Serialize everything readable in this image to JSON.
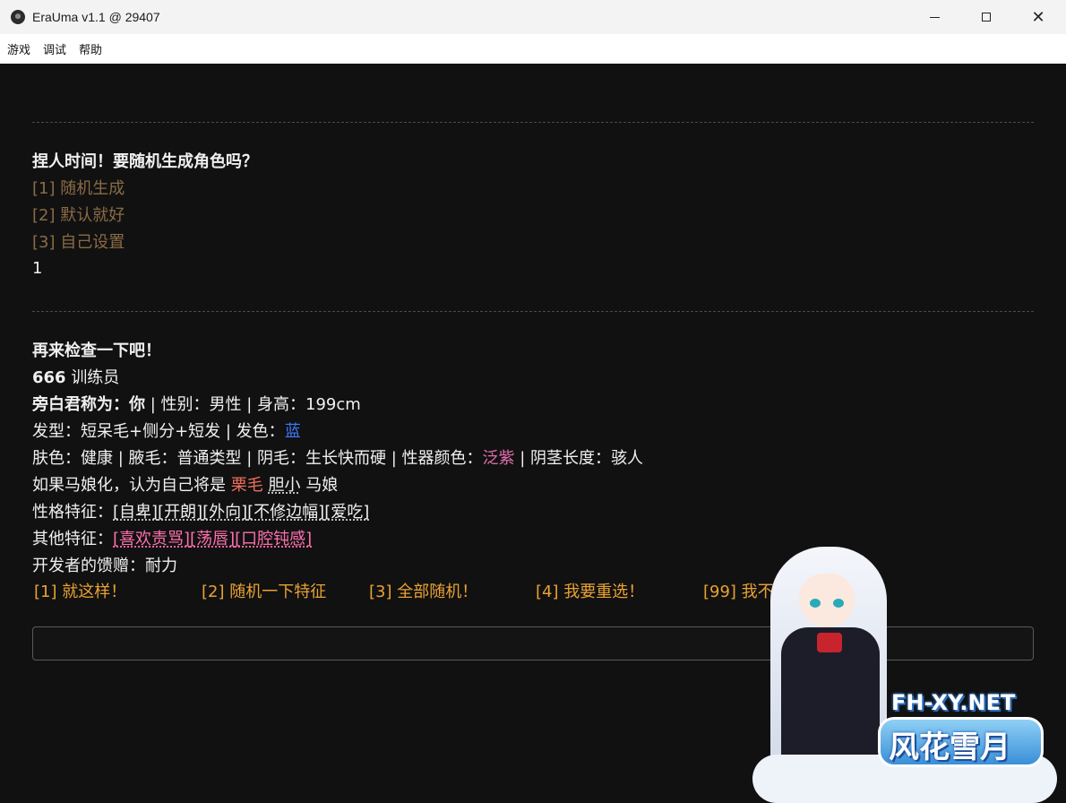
{
  "window": {
    "title": "EraUma v1.1 @ 29407"
  },
  "menu": [
    "游戏",
    "调试",
    "帮助"
  ],
  "section1": {
    "question": "捏人时间！要随机生成角色吗？",
    "options": [
      "[1] 随机生成",
      "[2] 默认就好",
      "[3] 自己设置"
    ],
    "answer": "1"
  },
  "section2": {
    "heading": "再来检查一下吧！",
    "id_line": {
      "number": "666",
      "role": "训练员"
    },
    "narration": {
      "label": "旁白君称为：",
      "value": "你",
      "gender_label": " | 性别：",
      "gender": "男性",
      "height_label": " | 身高：",
      "height": "199cm"
    },
    "hair": {
      "label": "发型：",
      "style": "短呆毛+侧分+短发",
      "color_label": " | 发色：",
      "color": "蓝"
    },
    "body": {
      "skin_label": "肤色：",
      "skin": "健康",
      "armpit_label": " | 腋毛：",
      "armpit": "普通类型",
      "pubic_label": " | 阴毛：",
      "pubic": "生长快而硬",
      "organ_color_label": " | 性器颜色：",
      "organ_color": "泛紫",
      "length_label": " | 阴茎长度：",
      "length": "骇人"
    },
    "uma": {
      "prefix": "如果马娘化，认为自己将是 ",
      "coat": "栗毛",
      "space1": " ",
      "temper": "胆小",
      "suffix": " 马娘"
    },
    "personality": {
      "label": "性格特征：",
      "traits": [
        "[自卑]",
        "[开朗]",
        "[外向]",
        "[不修边幅]",
        "[爱吃]"
      ]
    },
    "other": {
      "label": "其他特征：",
      "traits": [
        "[喜欢责骂]",
        "[荡唇]",
        "[口腔钝感]"
      ]
    },
    "gift": {
      "label": "开发者的馈赠：",
      "value": "耐力"
    }
  },
  "actions": [
    "[1] 就这样！",
    "[2] 随机一下特征",
    "[3] 全部随机！",
    "[4] 我要重选！",
    "[99] 我不玩了……"
  ],
  "watermark": {
    "site": "FH-XY.NET",
    "name": "风花雪月"
  },
  "colors": {
    "background": "#111111",
    "option": "#8a6b46",
    "action": "#e9a233",
    "blue": "#3a7bff",
    "pink": "#ff6fae"
  }
}
